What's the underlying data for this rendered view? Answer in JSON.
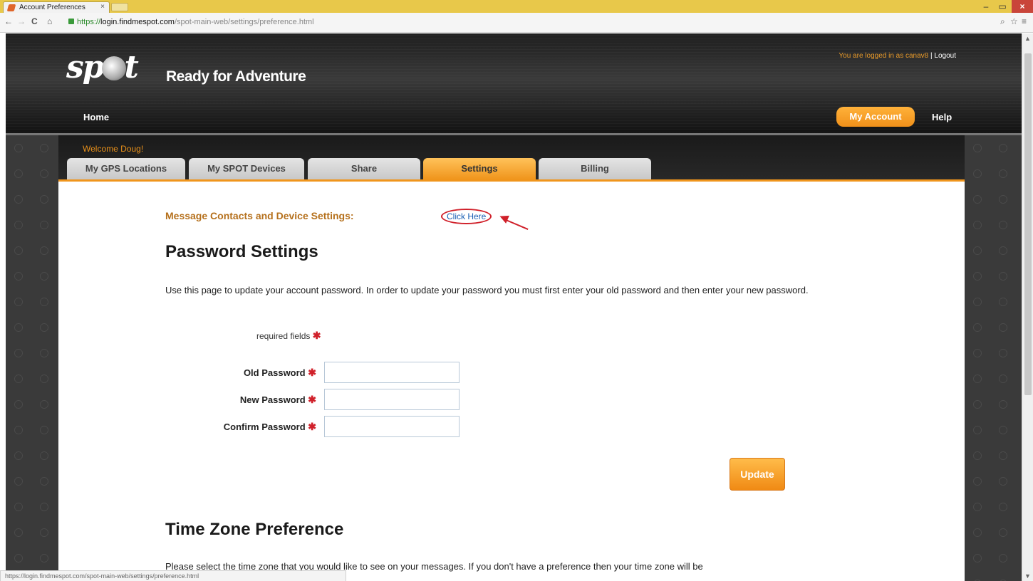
{
  "browser": {
    "tab_title": "Account Preferences",
    "tab_close": "×",
    "url_scheme": "https://",
    "url_host": "login.findmespot.com",
    "url_path": "/spot-main-web/settings/preference.html",
    "status_url": "https://login.findmespot.com/spot-main-web/settings/preference.html",
    "icons": [
      "back-icon",
      "forward-icon",
      "reload-icon",
      "home-icon",
      "lock-icon",
      "zoom-icon",
      "star-icon",
      "menu-icon"
    ]
  },
  "header": {
    "logo_text_left": "sp",
    "logo_text_right": "t",
    "tagline": "Ready for Adventure",
    "logged_in_text": "You are logged in as canav8",
    "separator": " | ",
    "logout": "Logout",
    "nav_home": "Home",
    "nav_my_account": "My Account",
    "nav_help": "Help"
  },
  "tabs": {
    "welcome": "Welcome Doug!",
    "items": [
      {
        "label": "My GPS Locations"
      },
      {
        "label": "My SPOT Devices"
      },
      {
        "label": "Share"
      },
      {
        "label": "Settings",
        "active": true
      },
      {
        "label": "Billing"
      }
    ]
  },
  "content": {
    "message_contacts_label": "Message Contacts and Device Settings:",
    "click_here": "Click Here",
    "password_heading": "Password Settings",
    "intro_text": "Use this page to update your account password. In order to update your password you must first enter your old password and then enter your new password.",
    "required_fields": "required fields",
    "required_star": "✱",
    "fields": {
      "old_password": {
        "label": "Old Password",
        "value": ""
      },
      "new_password": {
        "label": "New Password",
        "value": ""
      },
      "confirm_password": {
        "label": "Confirm Password",
        "value": ""
      }
    },
    "update_button": "Update",
    "timezone_heading": "Time Zone Preference",
    "timezone_text": "Please select the time zone that you would like to see on your messages. If you don't have a preference then your time zone will be"
  },
  "colors": {
    "accent_orange": "#f0951c",
    "header_dark": "#1e1e1e",
    "annotation_red": "#d0202a",
    "link_blue": "#1a5fb4"
  }
}
